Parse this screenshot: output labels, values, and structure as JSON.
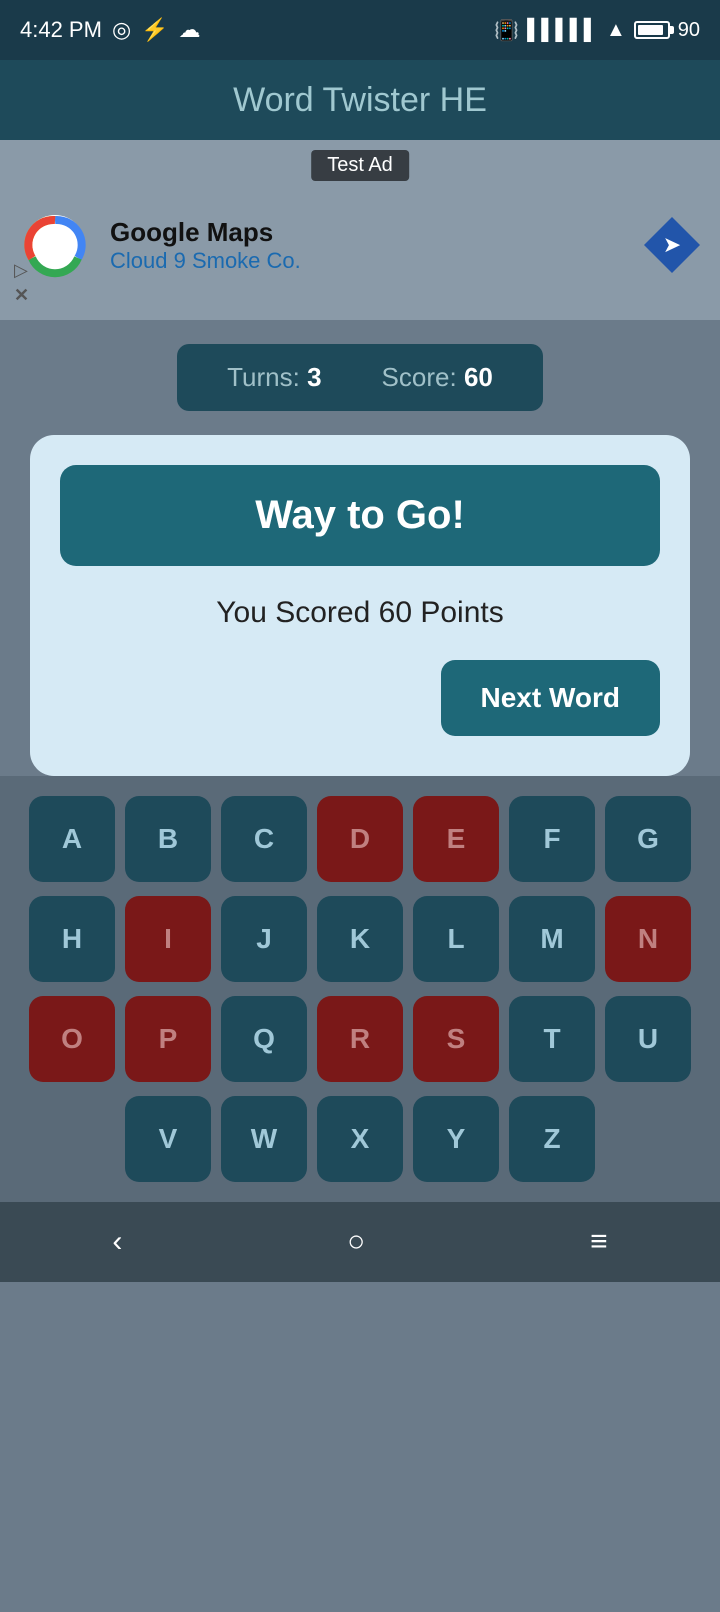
{
  "statusBar": {
    "time": "4:42 PM",
    "battery": "90"
  },
  "header": {
    "title": "Word Twister HE"
  },
  "ad": {
    "label": "Test Ad",
    "company": "Google Maps",
    "subtitle": "Cloud 9 Smoke Co."
  },
  "scoreBar": {
    "turnsLabel": "Turns:",
    "turnsValue": "3",
    "scoreLabel": "Score:",
    "scoreValue": "60"
  },
  "dialog": {
    "titleText": "Way to Go!",
    "bodyText": "You Scored 60 Points",
    "nextWordBtn": "Next Word"
  },
  "keyboard": {
    "rows": [
      [
        "A",
        "B",
        "C",
        "D",
        "E",
        "F",
        "G"
      ],
      [
        "H",
        "I",
        "J",
        "K",
        "L",
        "M",
        "N"
      ],
      [
        "O",
        "P",
        "Q",
        "R",
        "S",
        "T",
        "U"
      ],
      [
        "V",
        "W",
        "X",
        "Y",
        "Z"
      ]
    ],
    "usedKeys": [
      "D",
      "E",
      "I",
      "N",
      "O",
      "P",
      "R",
      "S"
    ]
  },
  "navBar": {
    "back": "‹",
    "home": "○",
    "menu": "≡"
  }
}
